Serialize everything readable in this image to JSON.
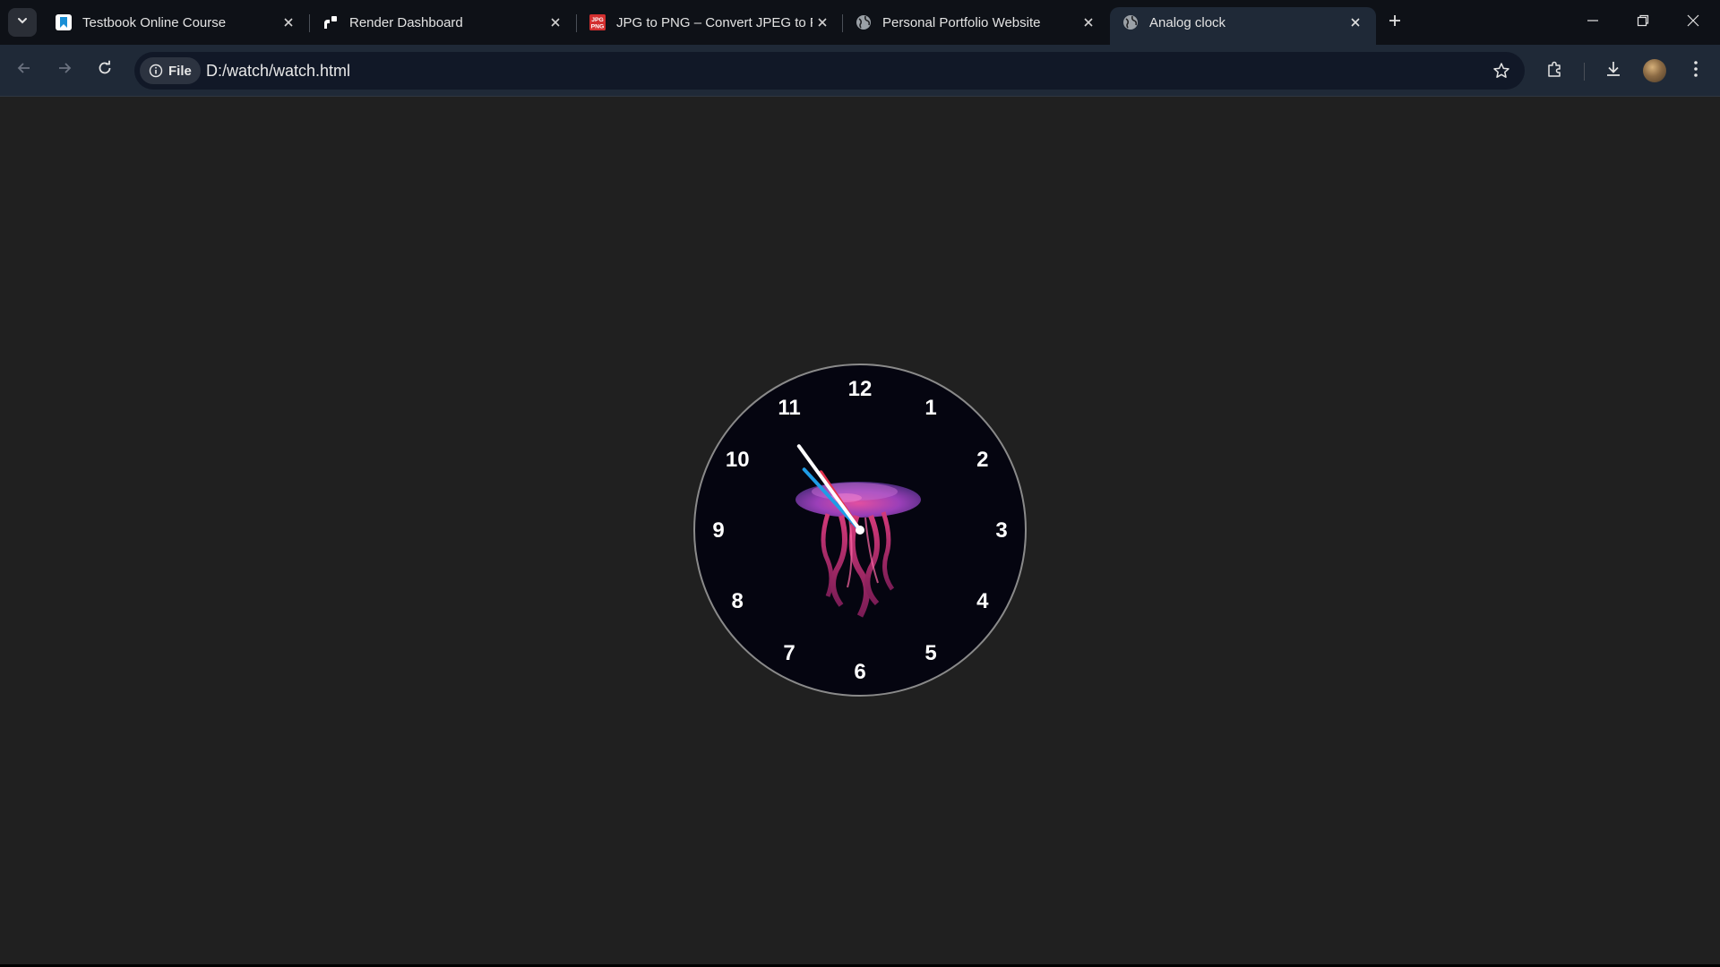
{
  "browser": {
    "tabs": [
      {
        "title": "Testbook Online Course",
        "favicon": "testbook-icon",
        "active": false
      },
      {
        "title": "Render Dashboard",
        "favicon": "render-icon",
        "active": false
      },
      {
        "title": "JPG to PNG – Convert JPEG to PNG",
        "favicon": "jpg-png-icon",
        "active": false
      },
      {
        "title": "Personal Portfolio Website",
        "favicon": "globe-icon",
        "active": false
      },
      {
        "title": "Analog clock",
        "favicon": "globe-icon",
        "active": true
      }
    ],
    "favicon_text": {
      "jpg": "JPG",
      "png": "PNG"
    },
    "address": {
      "chip_label": "File",
      "url": "D:/watch/watch.html"
    },
    "colors": {
      "tabstrip": "#0e1117",
      "toolbar": "#1f2937",
      "omnibox": "#111827"
    }
  },
  "clock": {
    "numerals": [
      "12",
      "1",
      "2",
      "3",
      "4",
      "5",
      "6",
      "7",
      "8",
      "9",
      "10",
      "11"
    ],
    "face_color": "#050510",
    "rim_color": "#8a8a8a",
    "center_image": "jellyfish-illustration",
    "time": {
      "hour": 10,
      "minute": 52,
      "second": 54
    },
    "hand_colors": {
      "hour": "#e2334d",
      "minute": "#1f9de6",
      "second": "#ffffff"
    }
  }
}
